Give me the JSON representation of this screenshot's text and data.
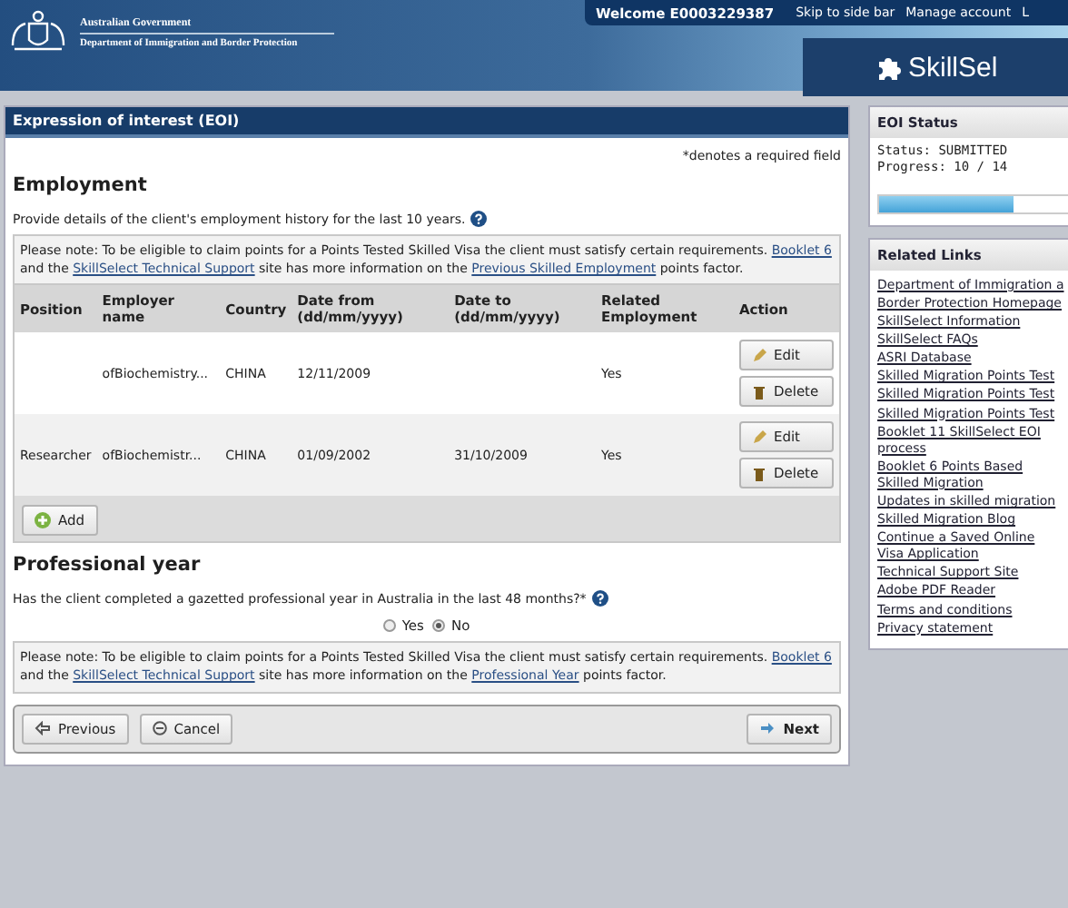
{
  "header": {
    "government": "Australian Government",
    "department": "Department of Immigration and Border Protection",
    "welcome": "Welcome E0003229387",
    "links": [
      "Skip to side bar",
      "Manage account",
      "L"
    ],
    "logo": "SkillSel"
  },
  "panel": {
    "title": "Expression of interest (EOI)",
    "required_note": "*denotes a required field",
    "employment": {
      "heading": "Employment",
      "intro": "Provide details of the client's employment history for the last 10 years.",
      "note": [
        {
          "kind": "text",
          "text": "Please note: To be eligible to claim points for a Points Tested Skilled Visa the client must satisfy certain requirements. "
        },
        {
          "kind": "link",
          "text": "Booklet 6"
        },
        {
          "kind": "text",
          "text": " and the "
        },
        {
          "kind": "link",
          "text": "SkillSelect Technical Support"
        },
        {
          "kind": "text",
          "text": " site has more information on the "
        },
        {
          "kind": "link",
          "text": "Previous Skilled Employment"
        },
        {
          "kind": "text",
          "text": " points factor."
        }
      ],
      "table": {
        "columns": [
          "Position",
          "Employer name",
          "Country",
          "Date from (dd/mm/yyyy)",
          "Date to (dd/mm/yyyy)",
          "Related Employment",
          "Action"
        ],
        "rows": [
          {
            "employer": "ofBiochemistry...",
            "country": "CHINA",
            "date_from": "12/11/2009",
            "related": "Yes",
            "actions": [
              "Edit",
              "Delete"
            ]
          },
          {
            "position": "Researcher",
            "employer": "ofBiochemistr...",
            "country": "CHINA",
            "date_from": "01/09/2002",
            "date_to": "31/10/2009",
            "related": "Yes",
            "actions": [
              "Edit",
              "Delete"
            ]
          }
        ]
      },
      "add_button": "Add"
    },
    "professional_year": {
      "heading": "Professional year",
      "question": "Has the client completed a gazetted professional year in Australia in the last 48 months?*",
      "options": [
        {
          "label": "Yes",
          "selected": false
        },
        {
          "label": "No",
          "selected": true
        }
      ],
      "note": [
        {
          "kind": "text",
          "text": "Please note: To be eligible to claim points for a Points Tested Skilled Visa the client must satisfy certain requirements. "
        },
        {
          "kind": "link",
          "text": "Booklet 6"
        },
        {
          "kind": "text",
          "text": " and the "
        },
        {
          "kind": "link",
          "text": "SkillSelect Technical Support"
        },
        {
          "kind": "text",
          "text": " site has more information on the "
        },
        {
          "kind": "link",
          "text": "Professional Year"
        },
        {
          "kind": "text",
          "text": " points factor."
        }
      ]
    },
    "buttons": {
      "previous": "Previous",
      "cancel": "Cancel",
      "next": "Next"
    }
  },
  "sidebar": {
    "status_box": {
      "title": "EOI Status",
      "status": "Status: SUBMITTED",
      "progress": "Progress: 10 / 14",
      "level": 0.71
    },
    "links_box": {
      "title": "Related Links",
      "links": [
        "Department of Immigration a",
        "Border Protection Homepage",
        "SkillSelect Information",
        "SkillSelect FAQs",
        "ASRI Database",
        "Skilled Migration Points Test",
        "Skilled Migration Points Test",
        "Skilled Migration Points Test",
        "Booklet 11 SkillSelect EOI process",
        "Booklet 6 Points Based Skilled Migration",
        "Updates in skilled migration",
        "Skilled Migration Blog",
        "Continue a Saved Online Visa Application",
        "Technical Support Site",
        "Adobe PDF Reader",
        "Terms and conditions",
        "Privacy statement"
      ]
    }
  }
}
